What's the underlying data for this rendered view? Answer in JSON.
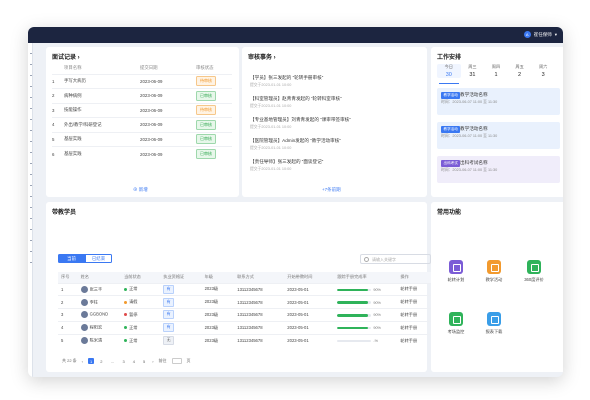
{
  "header": {
    "user_name": "崔任保师",
    "avatar_text": "A"
  },
  "records": {
    "title": "面试记录 ›",
    "columns": [
      "项目名称",
      "提交日期",
      "审核状态"
    ],
    "rows": [
      {
        "idx": "1",
        "name": "手写大病历",
        "date": "2023-06-09",
        "status": "待审核",
        "state": "pending"
      },
      {
        "idx": "2",
        "name": "病种病例",
        "date": "2023-06-09",
        "status": "已审核",
        "state": "ok"
      },
      {
        "idx": "3",
        "name": "技能操作",
        "date": "2023-06-09",
        "status": "待审核",
        "state": "pending"
      },
      {
        "idx": "4",
        "name": "外出/教学/科研登记",
        "date": "2023-06-09",
        "status": "已审核",
        "state": "ok"
      },
      {
        "idx": "5",
        "name": "基层实践",
        "date": "2023-06-09",
        "status": "已审核",
        "state": "ok"
      },
      {
        "idx": "6",
        "name": "基层实践",
        "date": "2023-06-09",
        "status": "已审核",
        "state": "ok"
      }
    ],
    "add_label": "⊕ 新增"
  },
  "audit": {
    "title": "审核事务 ›",
    "items": [
      {
        "title": "【学员】张三发起的 “轮转手册审核”",
        "time": "提交于2023-01-01 10:00"
      },
      {
        "title": "【科室管理员】赵青青发起的 “轮转科室审核”",
        "time": "提交于2023-01-01 10:00"
      },
      {
        "title": "【专业基地管理员】刘青青发起的 “课审带签审核”",
        "time": "提交于2023-01-01 10:00"
      },
      {
        "title": "【医院管理员】Admin发起的 “教学活动审核”",
        "time": "提交于2023-01-01 10:00"
      },
      {
        "title": "【责任导师】张三发起的 “面谈登记”",
        "time": "提交于2023-01-01 10:00"
      }
    ],
    "more_label": "+7条前期"
  },
  "schedule": {
    "title": "工作安排",
    "days": [
      {
        "name": "今日",
        "num": "30"
      },
      {
        "name": "周三",
        "num": "31"
      },
      {
        "name": "周四",
        "num": "1"
      },
      {
        "name": "周五",
        "num": "2"
      },
      {
        "name": "周六",
        "num": "3"
      }
    ],
    "items": [
      {
        "tag": "教学活动",
        "tag_color": "#3a78f2",
        "title": "教学活动名称",
        "time": "时间：2023-06-07 11:00 至 11:30",
        "bg": "#e9f1fd"
      },
      {
        "tag": "教学活动",
        "tag_color": "#3a78f2",
        "title": "教学活动名称",
        "time": "时间：2023-06-07 11:00 至 11:30",
        "bg": "#e9f1fd"
      },
      {
        "tag": "出科考试",
        "tag_color": "#7b5cd6",
        "title": "出科考试名称",
        "time": "时间：2023-06-07 11:00 至 11:30",
        "bg": "#f0edfa"
      }
    ]
  },
  "students": {
    "title": "带教学员",
    "tabs": [
      "当前",
      "已结束"
    ],
    "search_placeholder": "请输入关键字",
    "columns": [
      "序号",
      "姓名",
      "当前状态",
      "执业资格证",
      "年级",
      "联系方式",
      "开始带教时间",
      "跟踪手册完成率",
      "操作"
    ],
    "rows": [
      {
        "idx": "1",
        "name": "张三丰",
        "status": "正常",
        "status_color": "#2fb35a",
        "cert": "有",
        "cert_type": "blue",
        "grade": "2023级",
        "phone": "13112345678",
        "start": "2023-05-01",
        "rate": 0.9,
        "rate_text": "90%",
        "op": "轮转手册"
      },
      {
        "idx": "2",
        "name": "李柱",
        "status": "请假",
        "status_color": "#f29a2e",
        "cert": "有",
        "cert_type": "blue",
        "grade": "2023级",
        "phone": "13112345678",
        "start": "2023-05-01",
        "rate": 0.9,
        "rate_text": "90%",
        "op": "轮转手册"
      },
      {
        "idx": "3",
        "name": "GGBOND",
        "status": "暂停",
        "status_color": "#e04a4a",
        "cert": "有",
        "cert_type": "blue",
        "grade": "2023级",
        "phone": "13112345678",
        "start": "2023-05-01",
        "rate": 0.9,
        "rate_text": "90%",
        "op": "轮转手册"
      },
      {
        "idx": "4",
        "name": "程阳宏",
        "status": "正常",
        "status_color": "#2fb35a",
        "cert": "有",
        "cert_type": "blue",
        "grade": "2023级",
        "phone": "13112345678",
        "start": "2023-05-01",
        "rate": 0.9,
        "rate_text": "90%",
        "op": "轮转手册"
      },
      {
        "idx": "5",
        "name": "陈米清",
        "status": "正常",
        "status_color": "#2fb35a",
        "cert": "无",
        "cert_type": "grey",
        "grade": "2023级",
        "phone": "13112345678",
        "start": "2023-05-01",
        "rate": 0.0,
        "rate_text": "-%",
        "op": "轮转手册"
      }
    ],
    "pager": {
      "total": "共 22 条",
      "prev": "‹",
      "pages": [
        "1",
        "2",
        "…",
        "3",
        "4",
        "5"
      ],
      "current": "1",
      "next": "›",
      "goto": "前往",
      "unit": "页"
    }
  },
  "functions": {
    "title": "常用功能",
    "items": [
      {
        "label": "轮转计划",
        "color": "#7b5cd6",
        "icon": "calendar-icon"
      },
      {
        "label": "教学活动",
        "color": "#f29a2e",
        "icon": "teaching-icon"
      },
      {
        "label": "360度评价",
        "color": "#2fb35a",
        "icon": "evaluation-icon"
      },
      {
        "label": "考场监控",
        "color": "#2fb35a",
        "icon": "monitor-icon"
      },
      {
        "label": "报表下载",
        "color": "#3a9ee8",
        "icon": "report-icon"
      }
    ]
  }
}
